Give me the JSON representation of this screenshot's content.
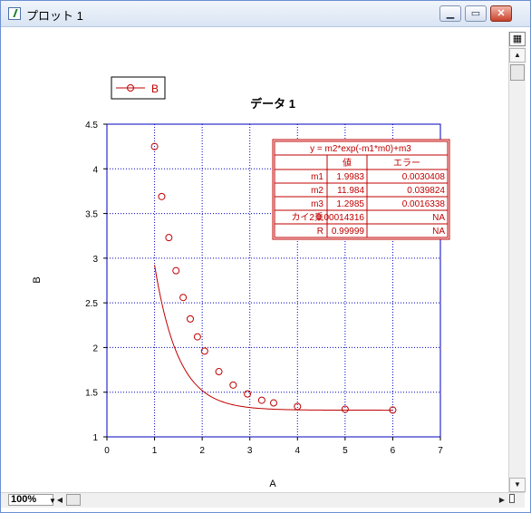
{
  "window": {
    "title": "プロット 1"
  },
  "controls": {
    "minimize": "▁",
    "restore": "▭",
    "close": "✕"
  },
  "zoom": {
    "value": "100%"
  },
  "chart_data": {
    "type": "scatter",
    "title": "データ 1",
    "xlabel": "A",
    "ylabel": "B",
    "xlim": [
      0,
      7
    ],
    "ylim": [
      1,
      4.5
    ],
    "xticks": [
      "0",
      "1",
      "2",
      "3",
      "4",
      "5",
      "6",
      "7"
    ],
    "yticks": [
      "1",
      "1.5",
      "2",
      "2.5",
      "3",
      "3.5",
      "4",
      "4.5"
    ],
    "grid": true,
    "legend": "top-left",
    "series": [
      {
        "name": "B",
        "x": [
          1.0,
          1.15,
          1.3,
          1.45,
          1.6,
          1.75,
          1.9,
          2.05,
          2.35,
          2.65,
          2.95,
          3.25,
          3.5,
          4.0,
          5.0,
          6.0
        ],
        "y": [
          4.25,
          3.69,
          3.23,
          2.86,
          2.56,
          2.32,
          2.12,
          1.96,
          1.73,
          1.58,
          1.48,
          1.41,
          1.38,
          1.34,
          1.31,
          1.3
        ]
      }
    ],
    "fit": {
      "m1": 1.9983,
      "m2": 11.984,
      "m3": 1.2985
    },
    "colors": {
      "series": "#c00000",
      "axis": "#0000c0",
      "grid": "#0000c0"
    }
  },
  "fit_table": {
    "equation": "y = m2*exp(-m1*m0)+m3",
    "col_value": "値",
    "col_error": "エラー",
    "rows": [
      {
        "name": "m1",
        "value": "1.9983",
        "error": "0.0030408"
      },
      {
        "name": "m2",
        "value": "11.984",
        "error": "0.039824"
      },
      {
        "name": "m3",
        "value": "1.2985",
        "error": "0.0016338"
      },
      {
        "name": "カイ2乗",
        "value": "0.00014316",
        "error": "NA"
      },
      {
        "name": "R",
        "value": "0.99999",
        "error": "NA"
      }
    ]
  }
}
